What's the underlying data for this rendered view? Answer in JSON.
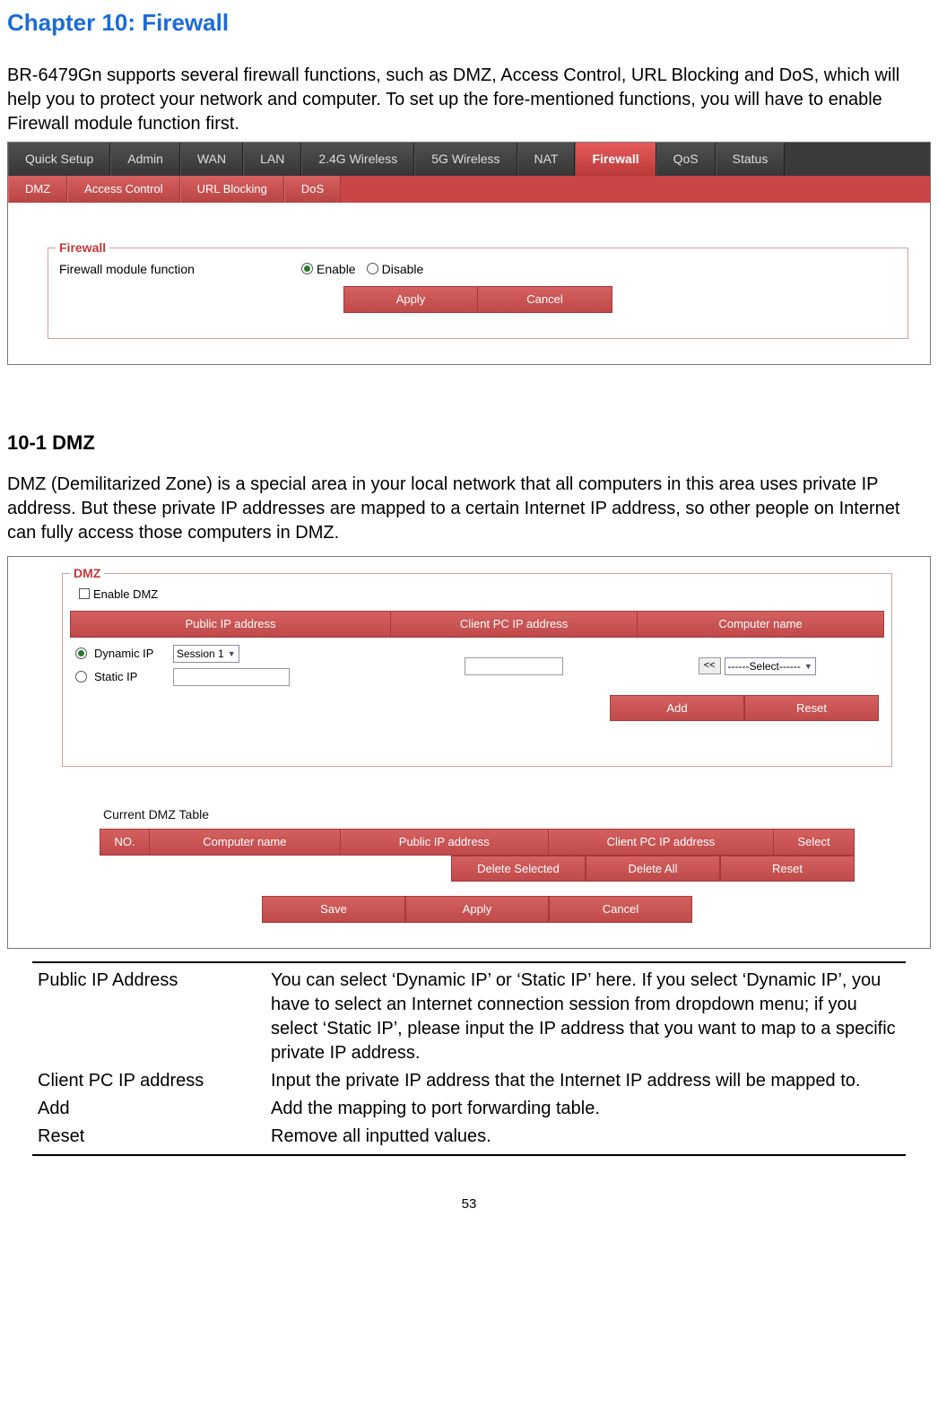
{
  "chapter_title": "Chapter 10: Firewall",
  "intro": "BR-6479Gn supports several firewall functions, such as DMZ, Access Control, URL Blocking and DoS, which will help you to protect your network and computer. To set up the fore-mentioned functions, you will have to enable Firewall module function first.",
  "main_tabs": {
    "t0": "Quick Setup",
    "t1": "Admin",
    "t2": "WAN",
    "t3": "LAN",
    "t4": "2.4G Wireless",
    "t5": "5G Wireless",
    "t6": "NAT",
    "t7": "Firewall",
    "t8": "QoS",
    "t9": "Status"
  },
  "sub_tabs": {
    "s0": "DMZ",
    "s1": "Access Control",
    "s2": "URL Blocking",
    "s3": "DoS"
  },
  "fw_panel": {
    "legend": "Firewall",
    "label": "Firewall module function",
    "enable": "Enable",
    "disable": "Disable",
    "apply": "Apply",
    "cancel": "Cancel"
  },
  "section": {
    "title": "10-1 DMZ",
    "para": "DMZ (Demilitarized Zone) is a special area in your local network that all computers in this area uses private IP address. But these private IP addresses are mapped to a certain Internet IP address, so other people on Internet can fully access those computers in DMZ."
  },
  "dmz_ui": {
    "legend": "DMZ",
    "enable_dmz": "Enable DMZ",
    "h_pub": "Public IP address",
    "h_cli": "Client PC IP address",
    "h_name": "Computer name",
    "dynamic": "Dynamic IP",
    "static": "Static IP",
    "session": "Session 1",
    "assign": "<<",
    "select_ph": "------Select------",
    "add": "Add",
    "reset": "Reset",
    "cur_title": "Current DMZ Table",
    "c_no": "NO.",
    "c_cn": "Computer name",
    "c_pi": "Public IP address",
    "c_ci": "Client PC IP address",
    "c_se": "Select",
    "del_sel": "Delete Selected",
    "del_all": "Delete All",
    "reset2": "Reset",
    "save": "Save",
    "apply": "Apply",
    "cancel": "Cancel"
  },
  "desc": {
    "r0t": "Public IP Address",
    "r0d": "You can select ‘Dynamic IP’ or ‘Static IP’ here. If you select ‘Dynamic IP’, you have to select an Internet connection session from dropdown menu; if you select ‘Static IP’, please input the IP address that you want to map to a specific private IP address.",
    "r1t": "Client PC IP address",
    "r1d": "Input the private IP address that the Internet IP address will be mapped to.",
    "r2t": "Add",
    "r2d": "Add the mapping to port forwarding table.",
    "r3t": "Reset",
    "r3d": "Remove all inputted values."
  },
  "page_number": "53"
}
